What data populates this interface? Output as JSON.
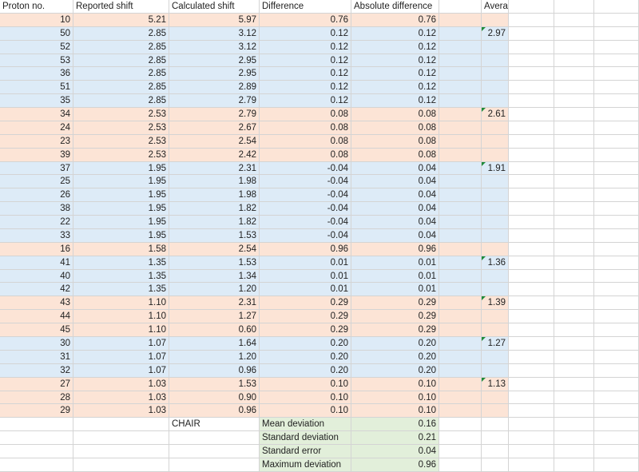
{
  "colors": {
    "peach": "#fce4d6",
    "blue": "#ddebf7",
    "green": "#e2efda",
    "gridline": "#d4d4d4",
    "comment_marker": "#1f8a3a"
  },
  "headers": [
    "Proton no.",
    "Reported shift",
    "Calculated shift",
    "Difference",
    "Absolute difference",
    "",
    "Average calculated shift"
  ],
  "rows": [
    {
      "proton": "10",
      "reported": "5.21",
      "calculated": "5.97",
      "difference": "0.76",
      "abs_difference": "0.76",
      "average": "",
      "fill": "peach"
    },
    {
      "proton": "50",
      "reported": "2.85",
      "calculated": "3.12",
      "difference": "0.12",
      "abs_difference": "0.12",
      "average": "2.97",
      "fill": "blue"
    },
    {
      "proton": "52",
      "reported": "2.85",
      "calculated": "3.12",
      "difference": "0.12",
      "abs_difference": "0.12",
      "average": "",
      "fill": "blue"
    },
    {
      "proton": "53",
      "reported": "2.85",
      "calculated": "2.95",
      "difference": "0.12",
      "abs_difference": "0.12",
      "average": "",
      "fill": "blue"
    },
    {
      "proton": "36",
      "reported": "2.85",
      "calculated": "2.95",
      "difference": "0.12",
      "abs_difference": "0.12",
      "average": "",
      "fill": "blue"
    },
    {
      "proton": "51",
      "reported": "2.85",
      "calculated": "2.89",
      "difference": "0.12",
      "abs_difference": "0.12",
      "average": "",
      "fill": "blue"
    },
    {
      "proton": "35",
      "reported": "2.85",
      "calculated": "2.79",
      "difference": "0.12",
      "abs_difference": "0.12",
      "average": "",
      "fill": "blue"
    },
    {
      "proton": "34",
      "reported": "2.53",
      "calculated": "2.79",
      "difference": "0.08",
      "abs_difference": "0.08",
      "average": "2.61",
      "fill": "peach"
    },
    {
      "proton": "24",
      "reported": "2.53",
      "calculated": "2.67",
      "difference": "0.08",
      "abs_difference": "0.08",
      "average": "",
      "fill": "peach"
    },
    {
      "proton": "23",
      "reported": "2.53",
      "calculated": "2.54",
      "difference": "0.08",
      "abs_difference": "0.08",
      "average": "",
      "fill": "peach"
    },
    {
      "proton": "39",
      "reported": "2.53",
      "calculated": "2.42",
      "difference": "0.08",
      "abs_difference": "0.08",
      "average": "",
      "fill": "peach"
    },
    {
      "proton": "37",
      "reported": "1.95",
      "calculated": "2.31",
      "difference": "-0.04",
      "abs_difference": "0.04",
      "average": "1.91",
      "fill": "blue"
    },
    {
      "proton": "25",
      "reported": "1.95",
      "calculated": "1.98",
      "difference": "-0.04",
      "abs_difference": "0.04",
      "average": "",
      "fill": "blue"
    },
    {
      "proton": "26",
      "reported": "1.95",
      "calculated": "1.98",
      "difference": "-0.04",
      "abs_difference": "0.04",
      "average": "",
      "fill": "blue"
    },
    {
      "proton": "38",
      "reported": "1.95",
      "calculated": "1.82",
      "difference": "-0.04",
      "abs_difference": "0.04",
      "average": "",
      "fill": "blue"
    },
    {
      "proton": "22",
      "reported": "1.95",
      "calculated": "1.82",
      "difference": "-0.04",
      "abs_difference": "0.04",
      "average": "",
      "fill": "blue"
    },
    {
      "proton": "33",
      "reported": "1.95",
      "calculated": "1.53",
      "difference": "-0.04",
      "abs_difference": "0.04",
      "average": "",
      "fill": "blue"
    },
    {
      "proton": "16",
      "reported": "1.58",
      "calculated": "2.54",
      "difference": "0.96",
      "abs_difference": "0.96",
      "average": "",
      "fill": "peach"
    },
    {
      "proton": "41",
      "reported": "1.35",
      "calculated": "1.53",
      "difference": "0.01",
      "abs_difference": "0.01",
      "average": "1.36",
      "fill": "blue"
    },
    {
      "proton": "40",
      "reported": "1.35",
      "calculated": "1.34",
      "difference": "0.01",
      "abs_difference": "0.01",
      "average": "",
      "fill": "blue"
    },
    {
      "proton": "42",
      "reported": "1.35",
      "calculated": "1.20",
      "difference": "0.01",
      "abs_difference": "0.01",
      "average": "",
      "fill": "blue"
    },
    {
      "proton": "43",
      "reported": "1.10",
      "calculated": "2.31",
      "difference": "0.29",
      "abs_difference": "0.29",
      "average": "1.39",
      "fill": "peach"
    },
    {
      "proton": "44",
      "reported": "1.10",
      "calculated": "1.27",
      "difference": "0.29",
      "abs_difference": "0.29",
      "average": "",
      "fill": "peach"
    },
    {
      "proton": "45",
      "reported": "1.10",
      "calculated": "0.60",
      "difference": "0.29",
      "abs_difference": "0.29",
      "average": "",
      "fill": "peach"
    },
    {
      "proton": "30",
      "reported": "1.07",
      "calculated": "1.64",
      "difference": "0.20",
      "abs_difference": "0.20",
      "average": "1.27",
      "fill": "blue"
    },
    {
      "proton": "31",
      "reported": "1.07",
      "calculated": "1.20",
      "difference": "0.20",
      "abs_difference": "0.20",
      "average": "",
      "fill": "blue"
    },
    {
      "proton": "32",
      "reported": "1.07",
      "calculated": "0.96",
      "difference": "0.20",
      "abs_difference": "0.20",
      "average": "",
      "fill": "blue"
    },
    {
      "proton": "27",
      "reported": "1.03",
      "calculated": "1.53",
      "difference": "0.10",
      "abs_difference": "0.10",
      "average": "1.13",
      "fill": "peach"
    },
    {
      "proton": "28",
      "reported": "1.03",
      "calculated": "0.90",
      "difference": "0.10",
      "abs_difference": "0.10",
      "average": "",
      "fill": "peach"
    },
    {
      "proton": "29",
      "reported": "1.03",
      "calculated": "0.96",
      "difference": "0.10",
      "abs_difference": "0.10",
      "average": "",
      "fill": "peach"
    }
  ],
  "method_label": "CHAIR",
  "stats": [
    {
      "label": "Mean deviation",
      "value": "0.16"
    },
    {
      "label": "Standard deviation",
      "value": "0.21"
    },
    {
      "label": "Standard error",
      "value": "0.04"
    },
    {
      "label": "Maximum deviation",
      "value": "0.96"
    }
  ]
}
